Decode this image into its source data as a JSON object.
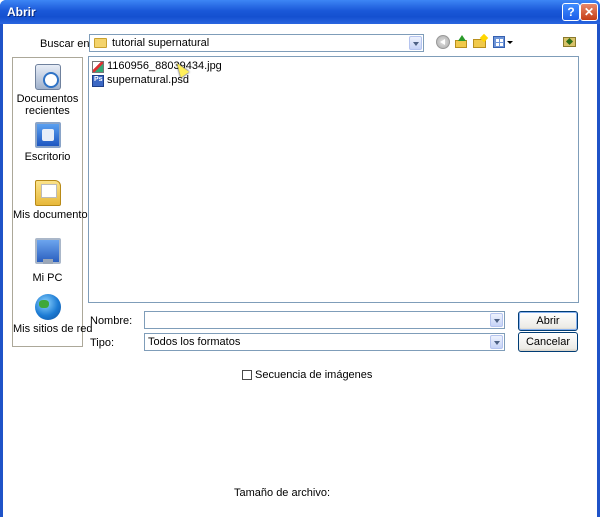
{
  "window": {
    "title": "Abrir",
    "help_glyph": "?",
    "close_glyph": "✕"
  },
  "lookin": {
    "label": "Buscar en:",
    "value": "tutorial supernatural"
  },
  "toolbar": {
    "icons": [
      "back-icon",
      "up-folder-icon",
      "new-folder-icon",
      "view-menu-icon",
      "favorites-folder-icon"
    ]
  },
  "places": [
    {
      "name": "recent-documents",
      "label_line1": "Documentos",
      "label_line2": "recientes",
      "icon": "recent-documents-icon"
    },
    {
      "name": "desktop",
      "label_line1": "Escritorio",
      "label_line2": "",
      "icon": "desktop-icon"
    },
    {
      "name": "my-documents",
      "label_line1": "Mis documentos",
      "label_line2": "",
      "icon": "my-documents-icon"
    },
    {
      "name": "my-pc",
      "label_line1": "Mi PC",
      "label_line2": "",
      "icon": "computer-icon"
    },
    {
      "name": "network",
      "label_line1": "Mis sitios de red",
      "label_line2": "",
      "icon": "network-icon"
    }
  ],
  "files": [
    {
      "name": "1160956_88039434.jpg",
      "icon": "jpg-file-icon"
    },
    {
      "name": "supernatural.psd",
      "icon": "psd-file-icon"
    }
  ],
  "filename": {
    "label": "Nombre:",
    "value": ""
  },
  "filetype": {
    "label": "Tipo:",
    "value": "Todos los formatos"
  },
  "buttons": {
    "open": "Abrir",
    "cancel": "Cancelar"
  },
  "image_sequence": {
    "label": "Secuencia de imágenes",
    "checked": false
  },
  "file_size": {
    "label": "Tamaño de archivo:"
  }
}
